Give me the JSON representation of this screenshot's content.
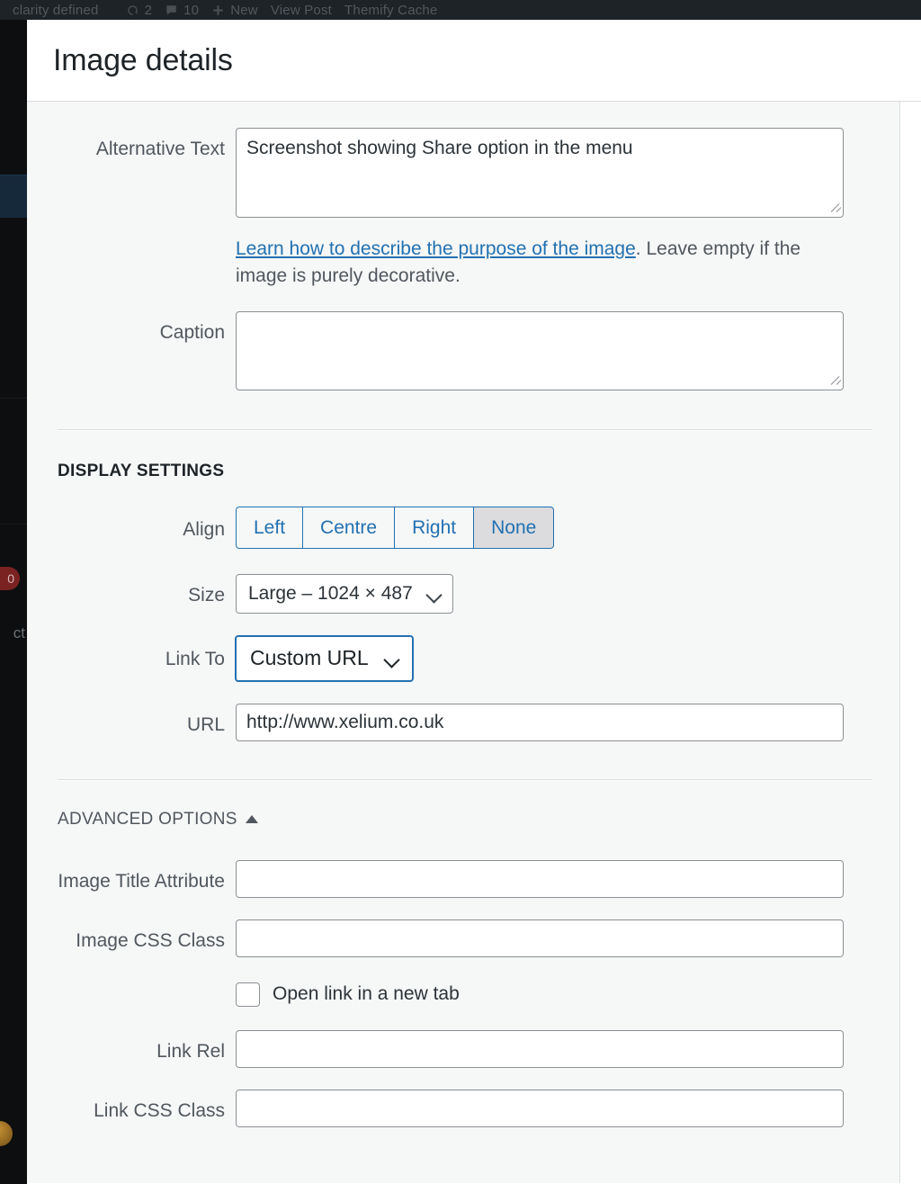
{
  "admin_bar": {
    "site_name": "clarity defined",
    "updates_icon": "updates-icon",
    "updates_count": "2",
    "comments_icon": "comment-bubble-icon",
    "comments_count": "10",
    "new_icon": "plus-icon",
    "new_label": "New",
    "view_post_label": "View Post",
    "themify_cache_label": "Themify Cache"
  },
  "admin_menu": {
    "badge_count": "0",
    "truncated_label": "ct"
  },
  "modal": {
    "title": "Image details"
  },
  "fields": {
    "alt_text": {
      "label": "Alternative Text",
      "value": "Screenshot showing Share option in the menu",
      "help_link": "Learn how to describe the purpose of the image",
      "help_rest": ". Leave empty if the image is purely decorative."
    },
    "caption": {
      "label": "Caption",
      "value": ""
    }
  },
  "display_settings": {
    "heading": "DISPLAY SETTINGS",
    "align": {
      "label": "Align",
      "options": [
        "Left",
        "Centre",
        "Right",
        "None"
      ],
      "selected": "None"
    },
    "size": {
      "label": "Size",
      "selected": "Large – 1024 × 487"
    },
    "link_to": {
      "label": "Link To",
      "selected": "Custom URL"
    },
    "url": {
      "label": "URL",
      "value": "http://www.xelium.co.uk"
    }
  },
  "advanced_options": {
    "heading": "ADVANCED OPTIONS",
    "toggle_icon": "caret-up-icon",
    "image_title_attribute": {
      "label": "Image Title Attribute",
      "value": ""
    },
    "image_css_class": {
      "label": "Image CSS Class",
      "value": ""
    },
    "open_in_new_tab": {
      "label": "Open link in a new tab",
      "checked": false
    },
    "link_rel": {
      "label": "Link Rel",
      "value": ""
    },
    "link_css_class": {
      "label": "Link CSS Class",
      "value": ""
    }
  },
  "colors": {
    "accent": "#2271b1",
    "admin_bar_bg": "#1d2327",
    "panel_bg": "#f6f7f7",
    "selected_button_bg": "#dcdcde",
    "badge_red": "#7a2222"
  }
}
